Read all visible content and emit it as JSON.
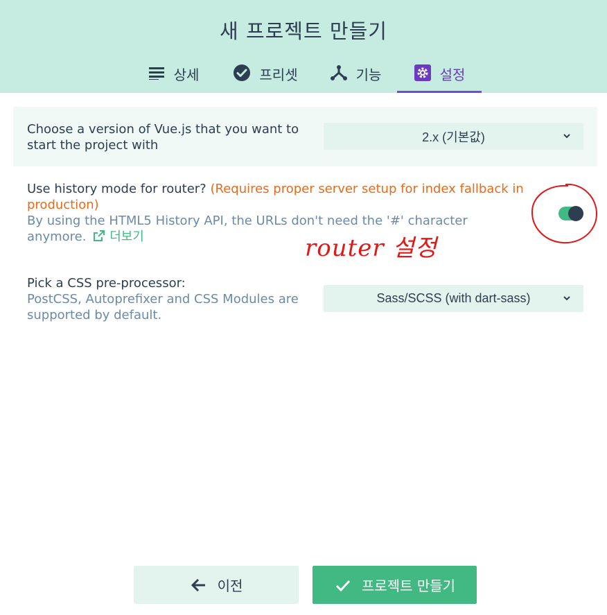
{
  "header": {
    "title": "새 프로젝트 만들기",
    "tabs": [
      {
        "label": "상세",
        "icon": "list-icon",
        "active": false
      },
      {
        "label": "프리셋",
        "icon": "check-circle-icon",
        "active": false
      },
      {
        "label": "기능",
        "icon": "fork-icon",
        "active": false
      },
      {
        "label": "설정",
        "icon": "gear-icon",
        "active": true
      }
    ]
  },
  "settings": {
    "vue_version": {
      "label": "Choose a version of Vue.js that you want to start the project with",
      "value": "2.x (기본값)"
    },
    "history_mode": {
      "label": "Use history mode for router?",
      "warning": "(Requires proper server setup for index fallback in production)",
      "description": "By using the HTML5 History API, the URLs don't need the '#' character anymore.",
      "more_label": "더보기",
      "enabled": true
    },
    "css_preprocessor": {
      "label": "Pick a CSS pre-processor:",
      "description": "PostCSS, Autoprefixer and CSS Modules are supported by default.",
      "value": "Sass/SCSS (with dart-sass)"
    }
  },
  "annotation": {
    "text": "router 설정"
  },
  "footer": {
    "prev_label": "이전",
    "create_label": "프로젝트 만들기"
  },
  "colors": {
    "accent": "#42b983",
    "header_bg": "#c6ebe0",
    "active_tab": "#6a3bc0",
    "warning": "#e86a1a",
    "annotation": "#e01818"
  }
}
